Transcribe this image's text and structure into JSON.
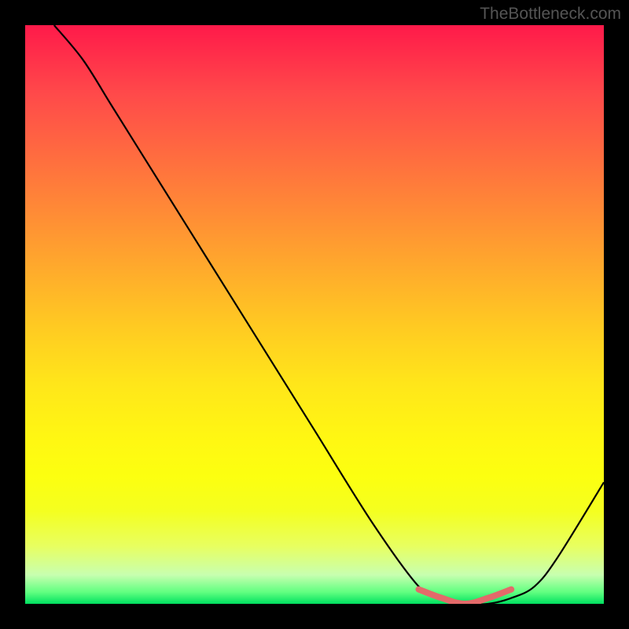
{
  "watermark": "TheBottleneck.com",
  "chart_data": {
    "type": "line",
    "title": "",
    "xlabel": "",
    "ylabel": "",
    "xlim": [
      0,
      1
    ],
    "ylim": [
      0,
      1
    ],
    "series": [
      {
        "name": "main-curve",
        "color": "#000000",
        "x": [
          0.05,
          0.1,
          0.15,
          0.2,
          0.3,
          0.4,
          0.5,
          0.6,
          0.68,
          0.72,
          0.76,
          0.8,
          0.84,
          0.88,
          0.92,
          1.0
        ],
        "y": [
          1.0,
          0.94,
          0.86,
          0.78,
          0.62,
          0.46,
          0.3,
          0.14,
          0.03,
          0.01,
          0.0,
          0.0,
          0.01,
          0.03,
          0.08,
          0.21
        ]
      },
      {
        "name": "highlight-segment",
        "color": "#e36a6a",
        "x": [
          0.68,
          0.72,
          0.76,
          0.8,
          0.84
        ],
        "y": [
          0.025,
          0.01,
          0.0,
          0.01,
          0.025
        ]
      }
    ]
  }
}
